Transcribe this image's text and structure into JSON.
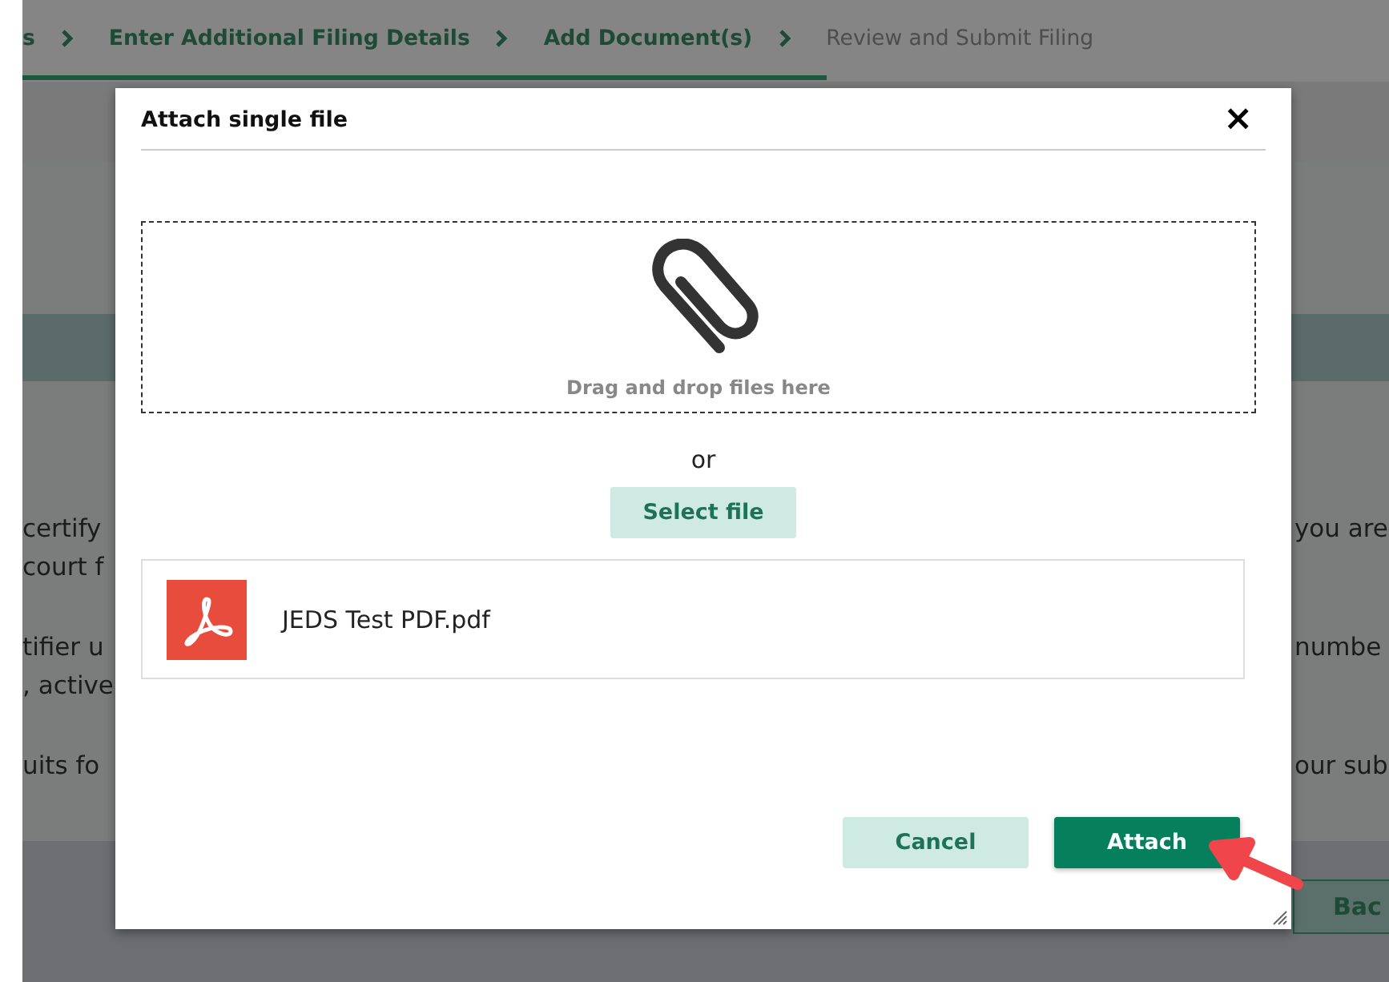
{
  "steps": [
    {
      "label": "s",
      "complete": true
    },
    {
      "label": "Enter Additional Filing Details",
      "complete": true
    },
    {
      "label": "Add Document(s)",
      "complete": true
    },
    {
      "label": "Review and Submit Filing",
      "complete": false
    }
  ],
  "background_text": [
    {
      "left": "certify",
      "right": "you are"
    },
    {
      "left": "court f"
    },
    {
      "left": "tifier u",
      "right": "numbe"
    },
    {
      "left": ", active"
    },
    {
      "left": "uits fo",
      "right": "our sub"
    }
  ],
  "back_button": "Bac",
  "dialog": {
    "title": "Attach single file",
    "close": "×",
    "dropzone": "Drag and drop files here",
    "or": "or",
    "select_button": "Select file",
    "files": [
      {
        "name": "JEDS Test PDF.pdf",
        "kind": "pdf"
      }
    ],
    "buttons": [
      {
        "label": "Cancel",
        "kind": "secondary"
      },
      {
        "label": "Attach",
        "kind": "primary"
      }
    ]
  }
}
